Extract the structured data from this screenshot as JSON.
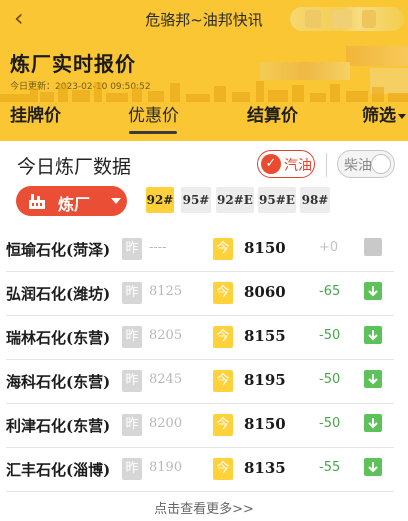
{
  "nav": {
    "back_icon": "chevron-left-icon",
    "title": "危骆邦~油邦快讯"
  },
  "header": {
    "title": "炼厂实时报价",
    "update_label": "今日更新",
    "update_time": "2023-02-10 09:50:52"
  },
  "tabs": [
    {
      "label": "挂牌价",
      "active": false
    },
    {
      "label": "优惠价",
      "active": true
    },
    {
      "label": "结算价",
      "active": false
    },
    {
      "label": "筛选",
      "active": false
    }
  ],
  "section": {
    "title": "今日炼厂数据"
  },
  "fuel_toggle": {
    "gasoline_label": "汽油",
    "gasoline_on": true,
    "diesel_label": "柴油",
    "diesel_on": false
  },
  "refinery_select": {
    "label": "炼厂",
    "icon": "factory-icon"
  },
  "grades": [
    {
      "label": "92#",
      "active": true
    },
    {
      "label": "95#",
      "active": false
    },
    {
      "label": "92#E",
      "active": false
    },
    {
      "label": "95#E",
      "active": false
    },
    {
      "label": "98#",
      "active": false
    }
  ],
  "badges": {
    "yesterday": "昨",
    "today": "今"
  },
  "rows": [
    {
      "name": "恒瑜石化(菏泽)",
      "yesterday": "----",
      "today": "8150",
      "change": "+0",
      "trend": "flat"
    },
    {
      "name": "弘润石化(潍坊)",
      "yesterday": "8125",
      "today": "8060",
      "change": "-65",
      "trend": "down"
    },
    {
      "name": "瑞林石化(东营)",
      "yesterday": "8205",
      "today": "8155",
      "change": "-50",
      "trend": "down"
    },
    {
      "name": "海科石化(东营)",
      "yesterday": "8245",
      "today": "8195",
      "change": "-50",
      "trend": "down"
    },
    {
      "name": "利津石化(东营)",
      "yesterday": "8200",
      "today": "8150",
      "change": "-50",
      "trend": "down"
    },
    {
      "name": "汇丰石化(淄博)",
      "yesterday": "8190",
      "today": "8135",
      "change": "-55",
      "trend": "down"
    }
  ],
  "footer": {
    "more_label": "点击查看更多>>"
  },
  "colors": {
    "header_bg": "#fbc633",
    "accent_red": "#ea4e34",
    "down_green": "#5ec25a",
    "today_badge": "#ffd23b"
  }
}
